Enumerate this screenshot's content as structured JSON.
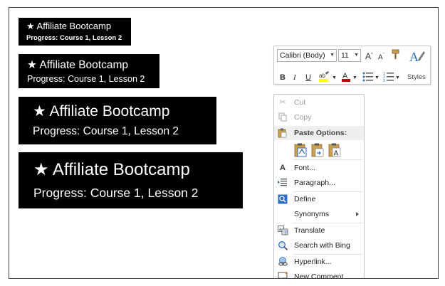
{
  "banners": [
    {
      "title": "★ Affiliate Bootcamp",
      "progress": "Progress: Course 1, Lesson 2"
    },
    {
      "title": "★ Affiliate Bootcamp",
      "progress": "Progress: Course 1, Lesson 2"
    },
    {
      "title": "★ Affiliate Bootcamp",
      "progress": "Progress: Course 1, Lesson 2"
    },
    {
      "title": "★ Affiliate Bootcamp",
      "progress": "Progress: Course 1, Lesson 2"
    }
  ],
  "mini_toolbar": {
    "font_name": "Calibri (Body)",
    "font_size": "11",
    "styles_label": "Styles",
    "highlight_color": "#ffff00",
    "font_color": "#c00000"
  },
  "context_menu": {
    "items": [
      {
        "label": "Cut",
        "enabled": false,
        "icon": "scissors-icon"
      },
      {
        "label": "Copy",
        "enabled": false,
        "icon": "copy-icon"
      },
      {
        "label": "Paste Options:",
        "header": true,
        "icon": "clipboard-icon"
      },
      {
        "label": "Font...",
        "icon": "font-icon"
      },
      {
        "label": "Paragraph...",
        "icon": "paragraph-icon"
      },
      {
        "label": "Define",
        "icon": "define-icon"
      },
      {
        "label": "Synonyms",
        "submenu": true
      },
      {
        "label": "Translate",
        "icon": "translate-icon"
      },
      {
        "label": "Search with Bing",
        "icon": "search-icon"
      },
      {
        "label": "Hyperlink...",
        "icon": "hyperlink-icon"
      },
      {
        "label": "New Comment",
        "icon": "comment-icon"
      }
    ]
  }
}
